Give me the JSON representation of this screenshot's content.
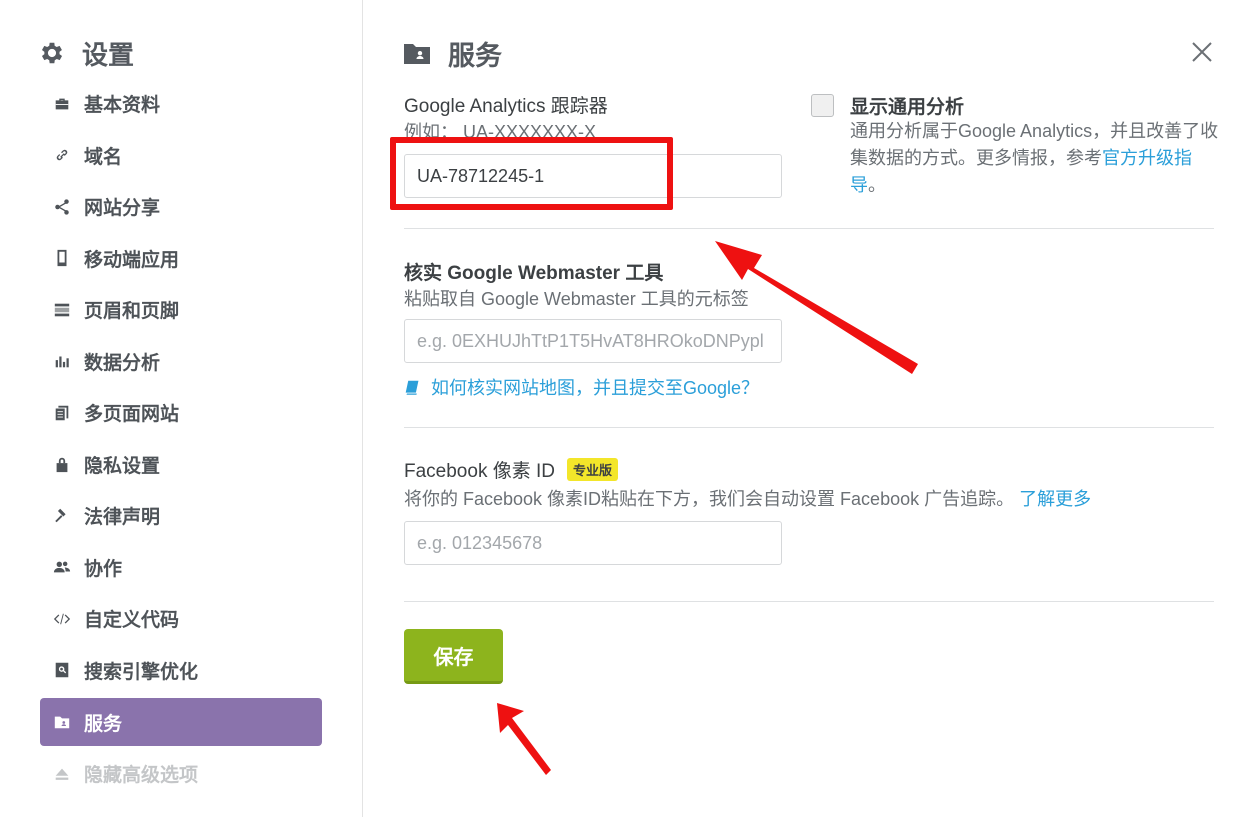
{
  "sidebar": {
    "title": "设置",
    "items": [
      {
        "label": "基本资料",
        "icon": "briefcase-icon"
      },
      {
        "label": "域名",
        "icon": "link-icon"
      },
      {
        "label": "网站分享",
        "icon": "share-icon"
      },
      {
        "label": "移动端应用",
        "icon": "mobile-icon"
      },
      {
        "label": "页眉和页脚",
        "icon": "header-footer-icon"
      },
      {
        "label": "数据分析",
        "icon": "bar-chart-icon"
      },
      {
        "label": "多页面网站",
        "icon": "pages-icon"
      },
      {
        "label": "隐私设置",
        "icon": "lock-icon"
      },
      {
        "label": "法律声明",
        "icon": "gavel-icon"
      },
      {
        "label": "协作",
        "icon": "users-icon"
      },
      {
        "label": "自定义代码",
        "icon": "code-icon"
      },
      {
        "label": "搜索引擎优化",
        "icon": "search-doc-icon"
      },
      {
        "label": "服务",
        "icon": "folder-user-icon",
        "active": true
      },
      {
        "label": "隐藏高级选项",
        "icon": "eject-icon",
        "muted": true
      }
    ]
  },
  "main": {
    "title": "服务",
    "google_analytics": {
      "label": "Google Analytics 跟踪器",
      "hint": "例如： UA-XXXXXXX-X",
      "value": "UA-78712245-1"
    },
    "universal_analytics": {
      "title": "显示通用分析",
      "desc": "通用分析属于Google Analytics，并且改善了收集数据的方式。更多情报，参考",
      "link": "官方升级指导",
      "suffix": "。"
    },
    "webmaster": {
      "label": "核实 Google Webmaster 工具",
      "hint": "粘贴取自 Google Webmaster 工具的元标签",
      "placeholder": "e.g. 0EXHUJhTtP1T5HvAT8HROkoDNPypl",
      "help_link": "如何核实网站地图，并且提交至Google？"
    },
    "facebook": {
      "label": "Facebook 像素 ID",
      "badge": "专业版",
      "hint": "将你的 Facebook 像素ID粘贴在下方，我们会自动设置 Facebook 广告追踪。",
      "link": "了解更多",
      "placeholder": "e.g. 012345678"
    },
    "save_label": "保存"
  },
  "colors": {
    "accent": "#8a73ac",
    "save": "#8db41d",
    "link": "#2b9fd9",
    "annotation": "#ee1111"
  }
}
